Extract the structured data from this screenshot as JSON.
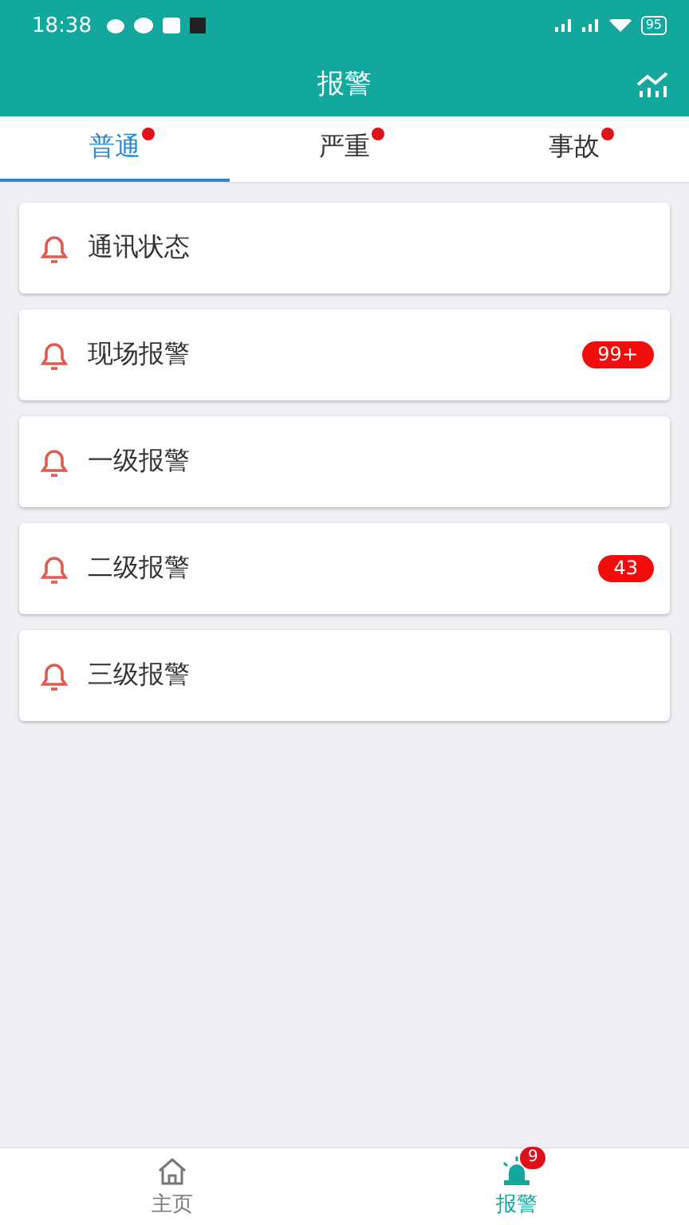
{
  "status_bar": {
    "time": "18:38",
    "battery": "95"
  },
  "header": {
    "title": "报警"
  },
  "tabs": [
    {
      "label": "普通",
      "selected": true,
      "dot": true
    },
    {
      "label": "严重",
      "selected": false,
      "dot": true
    },
    {
      "label": "事故",
      "selected": false,
      "dot": true
    }
  ],
  "alarms": [
    {
      "label": "通讯状态"
    },
    {
      "label": "现场报警",
      "count": "99+"
    },
    {
      "label": "一级报警"
    },
    {
      "label": "二级报警",
      "count": "43"
    },
    {
      "label": "三级报警"
    }
  ],
  "bottom_nav": [
    {
      "label": "主页",
      "kind": "home",
      "selected": false
    },
    {
      "label": "报警",
      "kind": "alarm",
      "selected": true,
      "badge": "9"
    }
  ]
}
